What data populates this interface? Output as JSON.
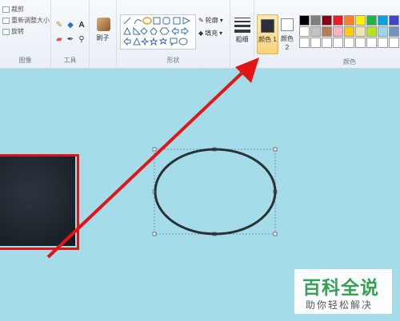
{
  "ribbon": {
    "image_group": {
      "items": [
        "裁剪",
        "重新调整大小",
        "旋转"
      ],
      "label": "图像"
    },
    "tools_group": {
      "label": "工具"
    },
    "brush": {
      "label": "刷子"
    },
    "shapes_group": {
      "outline_label": "轮廓",
      "fill_label": "填充",
      "label": "形状"
    },
    "size": {
      "label": "粗细"
    },
    "color1": {
      "label": "颜色 1",
      "value": "#2a3138"
    },
    "color2": {
      "label": "颜色 2",
      "value": "#ffffff"
    },
    "colors_group": {
      "label": "颜色",
      "swatches": [
        "#000000",
        "#7f7f7f",
        "#880015",
        "#ed1c24",
        "#ff7f27",
        "#fff200",
        "#22b14c",
        "#00a2e8",
        "#3f48cc",
        "#ffffff",
        "#c3c3c3",
        "#b97a57",
        "#ffaec9",
        "#ffc90e",
        "#efe4b0",
        "#b5e61d",
        "#99d9ea",
        "#7092be",
        "#ffffff",
        "#ffffff",
        "#ffffff",
        "#ffffff",
        "#ffffff",
        "#ffffff",
        "#ffffff",
        "#ffffff",
        "#ffffff"
      ]
    }
  },
  "watermark": {
    "title": "百科全说",
    "subtitle": "助你轻松解决"
  },
  "colors": {
    "canvas": "#a5dcea",
    "annotation": "#e01616"
  }
}
